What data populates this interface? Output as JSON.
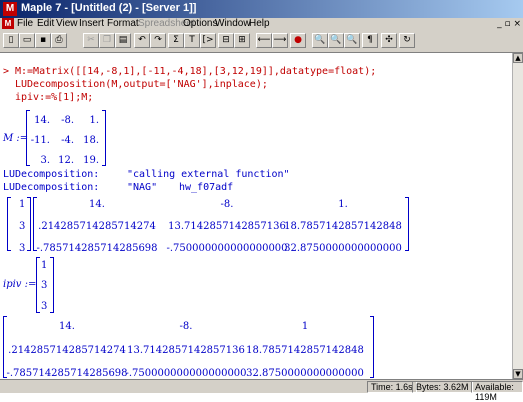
{
  "window": {
    "title": "Maple 7 - [Untitled (2) - [Server 1]]",
    "app_icon": "M"
  },
  "menu": [
    {
      "label": "File",
      "disabled": false
    },
    {
      "label": "Edit",
      "disabled": false
    },
    {
      "label": "View",
      "disabled": false
    },
    {
      "label": "Insert",
      "disabled": false
    },
    {
      "label": "Format",
      "disabled": false
    },
    {
      "label": "Spreadsheet",
      "disabled": true
    },
    {
      "label": "Options",
      "disabled": false
    },
    {
      "label": "Window",
      "disabled": false
    },
    {
      "label": "Help",
      "disabled": false
    }
  ],
  "window_buttons": {
    "minimize": "_",
    "restore": "▫",
    "close": "×"
  },
  "toolbar": {
    "buttons": [
      {
        "name": "new-icon",
        "glyph": "▯"
      },
      {
        "name": "open-icon",
        "glyph": "▭"
      },
      {
        "name": "save-icon",
        "glyph": "▪"
      },
      {
        "name": "print-icon",
        "glyph": "⎙"
      },
      {
        "name": "cut-icon",
        "glyph": "✂",
        "disabled": true
      },
      {
        "name": "copy-icon",
        "glyph": "❐",
        "disabled": true
      },
      {
        "name": "paste-icon",
        "glyph": "▤"
      },
      {
        "name": "undo-icon",
        "glyph": "↶"
      },
      {
        "name": "redo-icon",
        "glyph": "↷"
      },
      {
        "name": "sigma-icon",
        "glyph": "Σ"
      },
      {
        "name": "text-icon",
        "glyph": "T"
      },
      {
        "name": "input-icon",
        "glyph": "[>"
      },
      {
        "name": "group-icon",
        "glyph": "⊟"
      },
      {
        "name": "ungroup-icon",
        "glyph": "⊞"
      },
      {
        "name": "back-icon",
        "glyph": "⟵"
      },
      {
        "name": "forward-icon",
        "glyph": "⟶"
      },
      {
        "name": "stop-icon",
        "glyph": "●",
        "red": true
      },
      {
        "name": "zoom-small-icon",
        "glyph": "🔍"
      },
      {
        "name": "zoom-medium-icon",
        "glyph": "🔍"
      },
      {
        "name": "zoom-large-icon",
        "glyph": "🔍"
      },
      {
        "name": "paragraph-icon",
        "glyph": "¶"
      },
      {
        "name": "expand-icon",
        "glyph": "✣"
      },
      {
        "name": "restart-icon",
        "glyph": "↻"
      }
    ]
  },
  "worksheet": {
    "prompt": ">",
    "input_lines": [
      "M:=Matrix([[14,-8,1],[-11,-4,18],[3,12,19]],datatype=float);",
      "LUDecomposition(M,output=['NAG'],inplace);",
      "ipiv:=%[1];M;"
    ],
    "output_M": {
      "label": "M :=",
      "rows": [
        [
          "14.",
          "-8.",
          "1."
        ],
        [
          "-11.",
          "-4.",
          "18."
        ],
        [
          "3.",
          "12.",
          "19."
        ]
      ]
    },
    "userinfo": [
      {
        "fn": "LUDecomposition:",
        "msg": "\"calling external function\""
      },
      {
        "fn": "LUDecomposition:",
        "msg": "\"NAG\"",
        "extra": "hw_f07adf"
      }
    ],
    "nag_output": {
      "pivots": [
        "1",
        "3",
        "3"
      ],
      "rows": [
        [
          "14.",
          "-8.",
          "1."
        ],
        [
          ".214285714285714274",
          "13.7142857142857136",
          "18.7857142857142848"
        ],
        [
          "-.785714285714285698",
          "-.750000000000000000",
          "32.8750000000000000"
        ]
      ]
    },
    "ipiv_output": {
      "label": "ipiv :=",
      "values": [
        "1",
        "3",
        "3"
      ]
    },
    "final_M": {
      "rows": [
        [
          "14.",
          "-8.",
          "1"
        ],
        [
          ".214285714285714274",
          "13.7142857142857136",
          "18.7857142857142848"
        ],
        [
          "-.785714285714285698",
          "-.750000000000000000",
          "32.8750000000000000"
        ]
      ]
    }
  },
  "status": {
    "time": "Time: 1.6s",
    "bytes": "Bytes: 3.62M",
    "available": "Available: 119M"
  }
}
